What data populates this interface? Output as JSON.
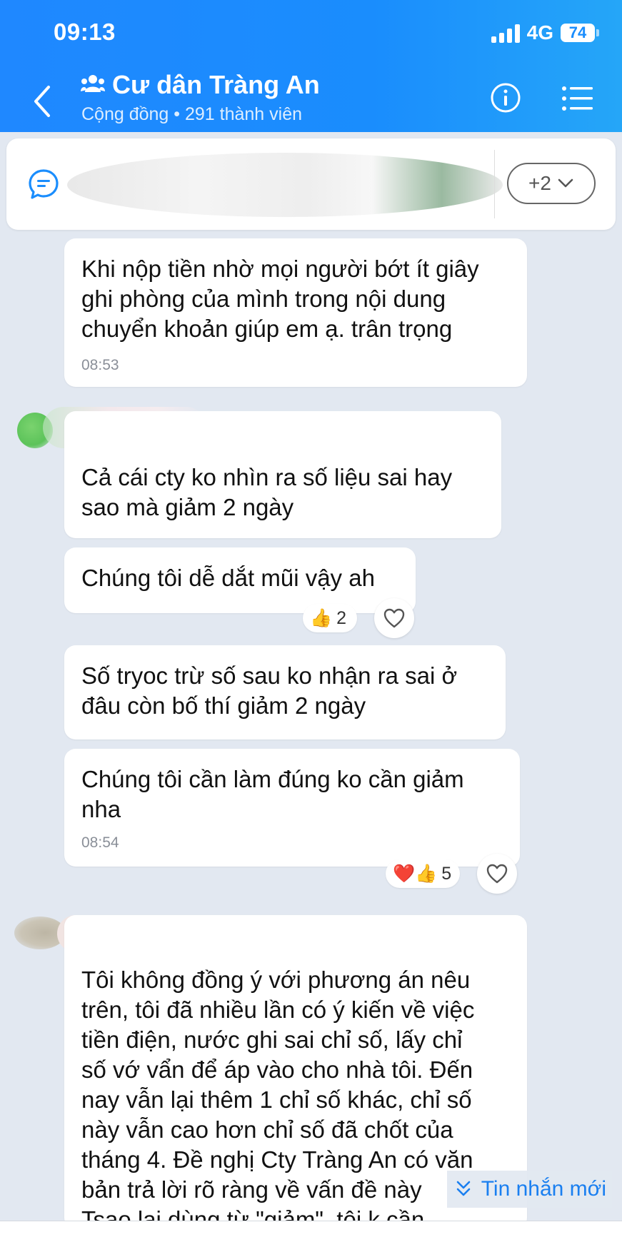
{
  "status_bar": {
    "time": "09:13",
    "network": "4G",
    "battery": "74"
  },
  "header": {
    "title": "Cư dân Tràng An",
    "subtitle": "Cộng đồng • 291 thành viên",
    "icons": {
      "back": "chevron-left-icon",
      "group": "group-icon",
      "info": "info-icon",
      "menu": "list-menu-icon"
    }
  },
  "pinned": {
    "icon": "chat-bubble-icon",
    "more_label": "+2"
  },
  "messages": [
    {
      "text": "Khi nộp tiền nhờ mọi người bớt ít giây\nghi phòng của mình trong nội dung\nchuyển khoản giúp em ạ. trân trọng",
      "time": "08:53"
    },
    {
      "text": "Cả cái cty ko nhìn ra số liệu sai hay\nsao mà giảm 2 ngày"
    },
    {
      "text": "Chúng tôi dễ dắt mũi vậy ah",
      "reaction": {
        "emoji": "👍",
        "count": "2"
      }
    },
    {
      "text": "Số tryoc trừ số sau ko nhận ra sai ở\nđâu còn bố thí giảm 2 ngày"
    },
    {
      "text": "Chúng tôi cần làm đúng ko cần giảm\nnha",
      "time": "08:54",
      "reaction": {
        "emoji": "❤️👍",
        "count": "5"
      }
    },
    {
      "text": "Tôi không đồng ý với phương án nêu\ntrên, tôi đã nhiều lần có ý kiến về việc\ntiền điện, nước ghi sai chỉ số, lấy chỉ\nsố vớ vẩn để áp vào cho nhà tôi. Đến\nnay vẫn lại thêm 1 chỉ số khác, chỉ số\nnày vẫn cao hơn chỉ số đã chốt của\ntháng 4. Đề nghị Cty Tràng An có văn\nbản trả lời rõ ràng về vấn đề này\nTsao lại dùng từ \"giảm\", tôi k cần"
    }
  ],
  "new_messages_label": "Tin nhắn mới"
}
